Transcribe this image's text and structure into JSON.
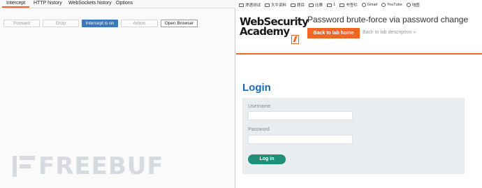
{
  "burp": {
    "tabs": [
      "Intercept",
      "HTTP history",
      "WebSockets history",
      "Options"
    ],
    "buttons": {
      "forward": "Forward",
      "drop": "Drop",
      "intercept": "Intercept is on",
      "action": "Action",
      "open_browser": "Open Browser"
    },
    "watermark": "FREEBUF"
  },
  "bookmarks": [
    "渗透测试",
    "大牛资料",
    "题目",
    "比赛",
    "1",
    "书签栏",
    "Gmail",
    "YouTube",
    "地图"
  ],
  "lab": {
    "logo_line1": "WebSecurity",
    "logo_line2": "Academy",
    "title": "Password brute-force via password change",
    "back_button": "Back to lab home",
    "back_description": "Back to lab description »"
  },
  "login": {
    "heading": "Login",
    "username_label": "Username",
    "username_value": "",
    "password_label": "Password",
    "password_value": "",
    "submit": "Log in"
  },
  "colors": {
    "accent": "#f26522",
    "intercept": "#3d79b8",
    "heading": "#1a6bb4",
    "login_button": "#1f8f77"
  }
}
